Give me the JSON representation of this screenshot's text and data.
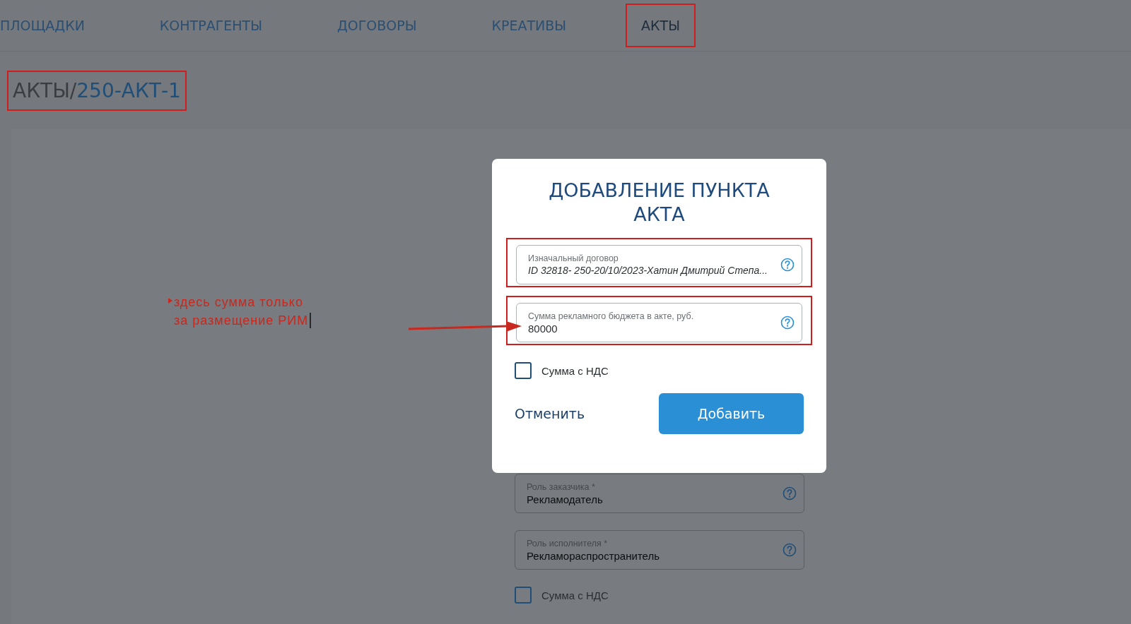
{
  "nav": {
    "items": [
      {
        "label": "ПЛОЩАДКИ",
        "selected": false,
        "highlighted": false
      },
      {
        "label": "КОНТРАГЕНТЫ",
        "selected": false,
        "highlighted": false
      },
      {
        "label": "ДОГОВОРЫ",
        "selected": false,
        "highlighted": false
      },
      {
        "label": "КРЕАТИВЫ",
        "selected": false,
        "highlighted": false
      },
      {
        "label": "АКТЫ",
        "selected": true,
        "highlighted": true
      }
    ]
  },
  "breadcrumb": {
    "parent": "АКТЫ/",
    "current": "250-АКТ-1",
    "highlighted": true
  },
  "background_form": {
    "fields": [
      {
        "label": "Роль заказчика *",
        "value": "Рекламодатель"
      },
      {
        "label": "Роль исполнителя *",
        "value": "Рекламораспространитель"
      }
    ],
    "checkbox": {
      "label": "Сумма с НДС",
      "checked": false
    }
  },
  "annotation": {
    "lines": [
      "здесь сумма только",
      "за размещение РИМ"
    ]
  },
  "dialog": {
    "title": "ДОБАВЛЕНИЕ ПУНКТА АКТА",
    "fields": [
      {
        "kind": "readonly",
        "label": "Изначальный договор",
        "value": "ID 32818- 250-20/10/2023-Хатин Дмитрий Степа...",
        "highlighted": true
      },
      {
        "kind": "input",
        "label": "Сумма рекламного бюджета в акте, руб.",
        "value": "80000",
        "highlighted": true
      }
    ],
    "checkbox": {
      "label": "Сумма с НДС",
      "checked": false
    },
    "cancel_button": "Отменить",
    "submit_button": "Добавить"
  }
}
